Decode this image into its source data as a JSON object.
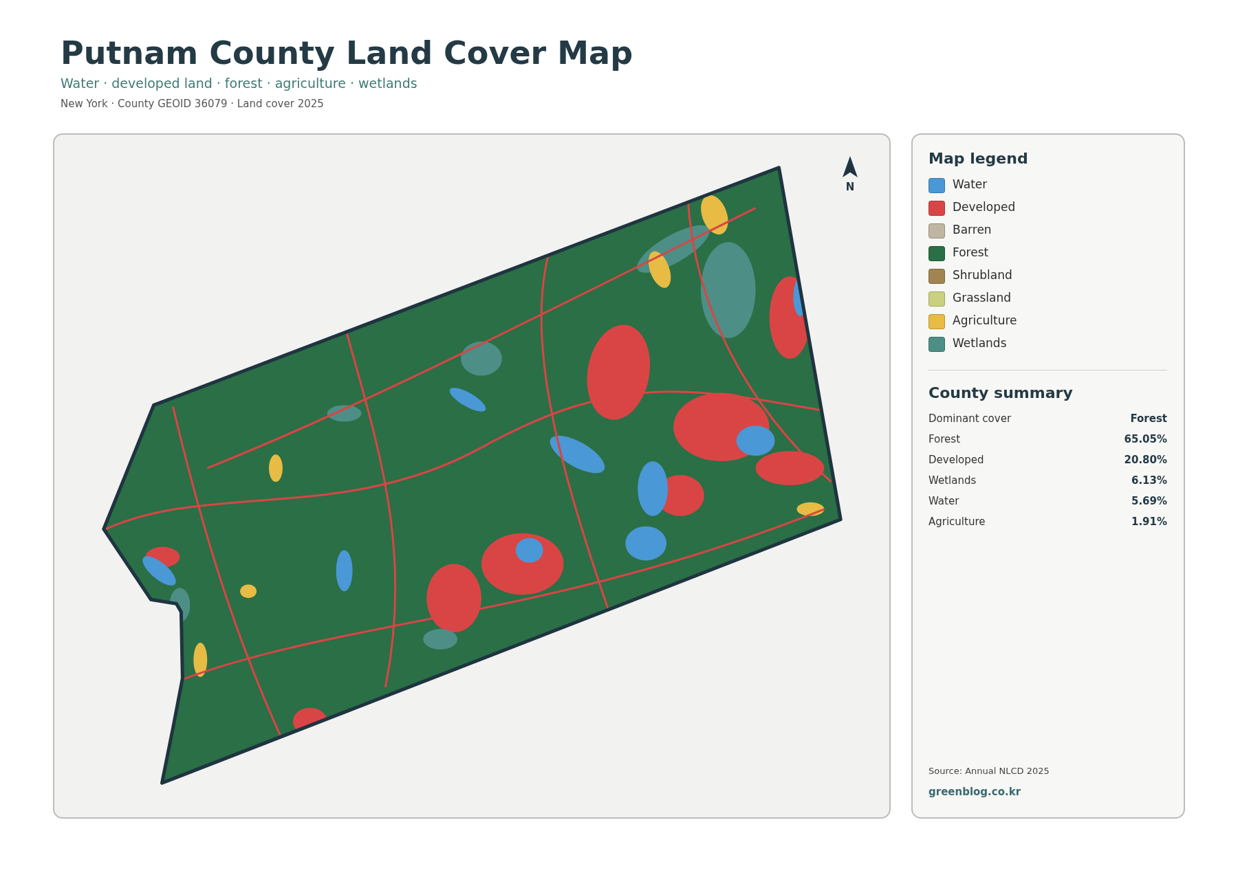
{
  "header": {
    "title": "Putnam County Land Cover Map",
    "subtitle": "Water · developed land · forest · agriculture · wetlands",
    "meta": "New York · County GEOID 36079 · Land cover 2025"
  },
  "map": {
    "north_label": "N"
  },
  "legend": {
    "title": "Map legend",
    "items": [
      {
        "label": "Water",
        "color": "#4a98d6"
      },
      {
        "label": "Developed",
        "color": "#d94545"
      },
      {
        "label": "Barren",
        "color": "#bfb5a3"
      },
      {
        "label": "Forest",
        "color": "#2a6f46"
      },
      {
        "label": "Shrubland",
        "color": "#a1844f"
      },
      {
        "label": "Grassland",
        "color": "#cbd081"
      },
      {
        "label": "Agriculture",
        "color": "#e8bb45"
      },
      {
        "label": "Wetlands",
        "color": "#4d8f86"
      }
    ]
  },
  "summary": {
    "title": "County summary",
    "rows": [
      {
        "label": "Dominant cover",
        "value": "Forest"
      },
      {
        "label": "Forest",
        "value": "65.05%"
      },
      {
        "label": "Developed",
        "value": "20.80%"
      },
      {
        "label": "Wetlands",
        "value": "6.13%"
      },
      {
        "label": "Water",
        "value": "5.69%"
      },
      {
        "label": "Agriculture",
        "value": "1.91%"
      }
    ]
  },
  "source": "Source: Annual NLCD 2025",
  "credit": "greenblog.co.kr"
}
